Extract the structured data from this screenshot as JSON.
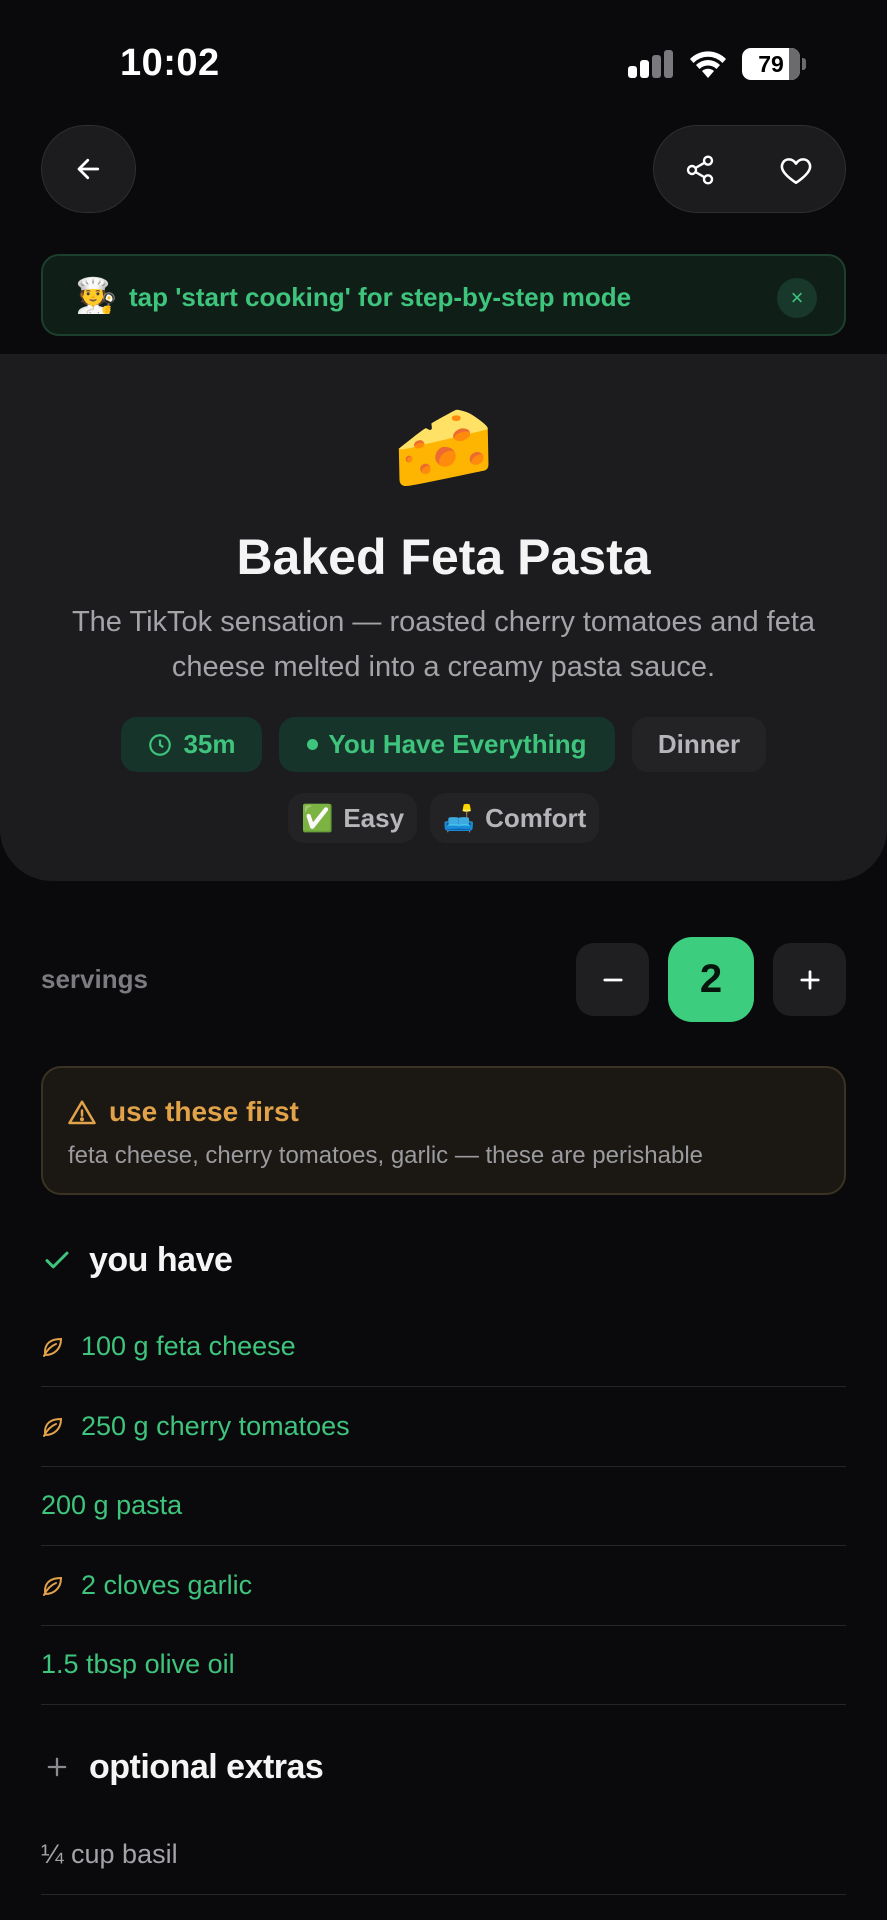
{
  "status_bar": {
    "time": "10:02",
    "battery": "79"
  },
  "tip": {
    "emoji": "🧑‍🍳",
    "text": "tap 'start cooking' for step-by-step mode",
    "close": "×"
  },
  "recipe": {
    "emoji": "🧀",
    "title": "Baked Feta Pasta",
    "description": "The TikTok sensation — roasted cherry tomatoes and feta cheese melted into a creamy pasta sauce.",
    "time": "35m",
    "availability": "You Have Everything",
    "meal": "Dinner",
    "difficulty_emoji": "✅",
    "difficulty": "Easy",
    "mood_emoji": "🛋️",
    "mood": "Comfort"
  },
  "servings": {
    "label": "servings",
    "value": "2"
  },
  "warning": {
    "title": "use these first",
    "text": "feta cheese, cherry tomatoes, garlic — these are perishable"
  },
  "have_section": {
    "title": "you have",
    "items": [
      {
        "text": "100 g feta cheese",
        "perishable": true
      },
      {
        "text": "250 g cherry tomatoes",
        "perishable": true
      },
      {
        "text": "200 g pasta",
        "perishable": false
      },
      {
        "text": "2 cloves garlic",
        "perishable": true
      },
      {
        "text": "1.5 tbsp olive oil",
        "perishable": false
      }
    ]
  },
  "extras_section": {
    "title": "optional extras",
    "items": [
      {
        "text": "¼ cup basil"
      }
    ]
  },
  "colors": {
    "accent_green": "#3ec47c",
    "warning_orange": "#e2a24a",
    "background": "#0a0a0c",
    "card": "#1c1c1f"
  }
}
